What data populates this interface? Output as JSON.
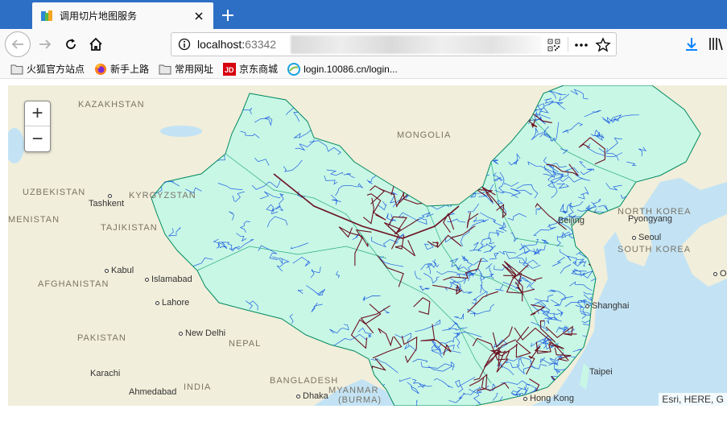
{
  "tab": {
    "title": "调用切片地图服务",
    "favicon": "arcgis-favicon-icon"
  },
  "nav": {
    "url_host": "localhost:",
    "url_port": "63342",
    "icons": [
      "back-icon",
      "forward-icon",
      "reload-icon",
      "home-icon",
      "info-icon",
      "qr-code-icon",
      "more-icon",
      "star-icon",
      "download-icon",
      "library-icon"
    ]
  },
  "bookmarks": [
    {
      "label": "火狐官方站点",
      "icon": "folder-icon"
    },
    {
      "label": "新手上路",
      "icon": "firefox-icon"
    },
    {
      "label": "常用网址",
      "icon": "folder-icon"
    },
    {
      "label": "京东商城",
      "icon": "jd-icon"
    },
    {
      "label": "login.10086.cn/login...",
      "icon": "china-mobile-icon"
    }
  ],
  "map": {
    "zoom_in": "+",
    "zoom_out": "−",
    "attribution": "Esri, HERE, G",
    "colors": {
      "water": "#c3e3f4",
      "land": "#f1eedb",
      "china_fill": "#c8f7e6",
      "rivers": "#1f5fe0",
      "railways": "#6b1020"
    },
    "countries": [
      "KAZAKHSTAN",
      "MONGOLIA",
      "UZBEKISTAN",
      "KYRGYZSTAN",
      "MENISTAN",
      "TAJIKISTAN",
      "AFGHANISTAN",
      "PAKISTAN",
      "NEPAL",
      "INDIA",
      "BANGLADESH",
      "MYANMAR",
      "(BURMA)",
      "NORTH KOREA",
      "SOUTH KOREA"
    ],
    "cities": [
      "Tashkent",
      "Kabul",
      "Islamabad",
      "Lahore",
      "New Delhi",
      "Karachi",
      "Ahmedabad",
      "Dhaka",
      "Beijing",
      "Pyongyang",
      "Seoul",
      "Shanghai",
      "Taipei",
      "Hong Kong",
      "Os"
    ]
  }
}
